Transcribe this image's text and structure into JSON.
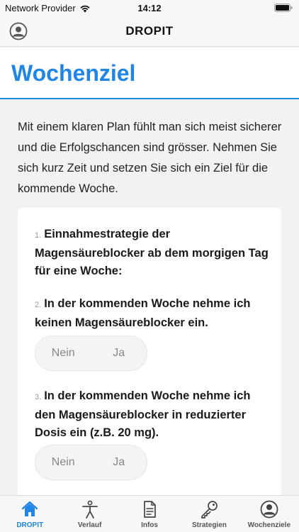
{
  "status_bar": {
    "carrier": "Network Provider",
    "time": "14:12"
  },
  "nav": {
    "title": "DROPIT"
  },
  "header": {
    "title": "Wochenziel"
  },
  "intro": {
    "text": "Mit einem klaren Plan fühlt man sich meist sicherer und die Erfolgschancen sind grösser. Nehmen Sie sich kurz Zeit und setzen Sie sich ein Ziel für die kommende Woche."
  },
  "questions": [
    {
      "number": "1.",
      "text": "Einnahmestrategie der Magensäureblocker ab dem morgigen Tag für eine Woche:"
    },
    {
      "number": "2.",
      "text": "In der kommenden Woche nehme ich keinen Magensäureblocker ein.",
      "options": [
        "Nein",
        "Ja"
      ]
    },
    {
      "number": "3.",
      "text": "In der kommenden Woche nehme ich den Magensäureblocker in reduzierter Dosis ein (z.B. 20 mg).",
      "options": [
        "Nein",
        "Ja"
      ]
    }
  ],
  "tabs": [
    {
      "label": "DROPIT",
      "icon": "home-icon",
      "active": true
    },
    {
      "label": "Verlauf",
      "icon": "person-icon",
      "active": false
    },
    {
      "label": "Infos",
      "icon": "document-icon",
      "active": false
    },
    {
      "label": "Strategien",
      "icon": "key-icon",
      "active": false
    },
    {
      "label": "Wochenziele",
      "icon": "profile-icon",
      "active": false
    }
  ],
  "colors": {
    "accent": "#1f86e5",
    "background": "#f2f2f2",
    "card": "#ffffff"
  }
}
